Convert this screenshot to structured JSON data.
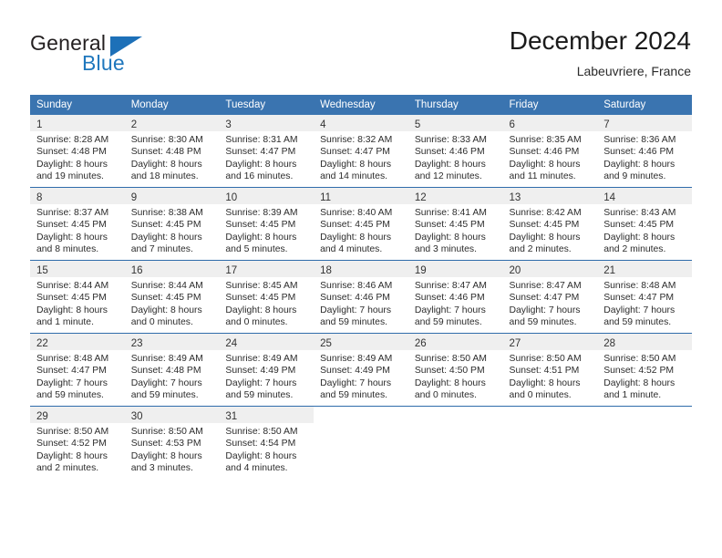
{
  "logo": {
    "word_top": "General",
    "word_bottom": "Blue",
    "mark": "sail-triangle",
    "color_black": "#231f20",
    "color_blue": "#1f77bd"
  },
  "header": {
    "title": "December 2024",
    "subtitle": "Labeuvriere, France"
  },
  "theme": {
    "header_blue": "#3a74b0",
    "row_divider_blue": "#2f6cab",
    "daynum_band": "#efefef"
  },
  "calendar": {
    "weekday_headers": [
      "Sunday",
      "Monday",
      "Tuesday",
      "Wednesday",
      "Thursday",
      "Friday",
      "Saturday"
    ],
    "weeks": [
      [
        {
          "day": "1",
          "sunrise": "Sunrise: 8:28 AM",
          "sunset": "Sunset: 4:48 PM",
          "daylight1": "Daylight: 8 hours",
          "daylight2": "and 19 minutes."
        },
        {
          "day": "2",
          "sunrise": "Sunrise: 8:30 AM",
          "sunset": "Sunset: 4:48 PM",
          "daylight1": "Daylight: 8 hours",
          "daylight2": "and 18 minutes."
        },
        {
          "day": "3",
          "sunrise": "Sunrise: 8:31 AM",
          "sunset": "Sunset: 4:47 PM",
          "daylight1": "Daylight: 8 hours",
          "daylight2": "and 16 minutes."
        },
        {
          "day": "4",
          "sunrise": "Sunrise: 8:32 AM",
          "sunset": "Sunset: 4:47 PM",
          "daylight1": "Daylight: 8 hours",
          "daylight2": "and 14 minutes."
        },
        {
          "day": "5",
          "sunrise": "Sunrise: 8:33 AM",
          "sunset": "Sunset: 4:46 PM",
          "daylight1": "Daylight: 8 hours",
          "daylight2": "and 12 minutes."
        },
        {
          "day": "6",
          "sunrise": "Sunrise: 8:35 AM",
          "sunset": "Sunset: 4:46 PM",
          "daylight1": "Daylight: 8 hours",
          "daylight2": "and 11 minutes."
        },
        {
          "day": "7",
          "sunrise": "Sunrise: 8:36 AM",
          "sunset": "Sunset: 4:46 PM",
          "daylight1": "Daylight: 8 hours",
          "daylight2": "and 9 minutes."
        }
      ],
      [
        {
          "day": "8",
          "sunrise": "Sunrise: 8:37 AM",
          "sunset": "Sunset: 4:45 PM",
          "daylight1": "Daylight: 8 hours",
          "daylight2": "and 8 minutes."
        },
        {
          "day": "9",
          "sunrise": "Sunrise: 8:38 AM",
          "sunset": "Sunset: 4:45 PM",
          "daylight1": "Daylight: 8 hours",
          "daylight2": "and 7 minutes."
        },
        {
          "day": "10",
          "sunrise": "Sunrise: 8:39 AM",
          "sunset": "Sunset: 4:45 PM",
          "daylight1": "Daylight: 8 hours",
          "daylight2": "and 5 minutes."
        },
        {
          "day": "11",
          "sunrise": "Sunrise: 8:40 AM",
          "sunset": "Sunset: 4:45 PM",
          "daylight1": "Daylight: 8 hours",
          "daylight2": "and 4 minutes."
        },
        {
          "day": "12",
          "sunrise": "Sunrise: 8:41 AM",
          "sunset": "Sunset: 4:45 PM",
          "daylight1": "Daylight: 8 hours",
          "daylight2": "and 3 minutes."
        },
        {
          "day": "13",
          "sunrise": "Sunrise: 8:42 AM",
          "sunset": "Sunset: 4:45 PM",
          "daylight1": "Daylight: 8 hours",
          "daylight2": "and 2 minutes."
        },
        {
          "day": "14",
          "sunrise": "Sunrise: 8:43 AM",
          "sunset": "Sunset: 4:45 PM",
          "daylight1": "Daylight: 8 hours",
          "daylight2": "and 2 minutes."
        }
      ],
      [
        {
          "day": "15",
          "sunrise": "Sunrise: 8:44 AM",
          "sunset": "Sunset: 4:45 PM",
          "daylight1": "Daylight: 8 hours",
          "daylight2": "and 1 minute."
        },
        {
          "day": "16",
          "sunrise": "Sunrise: 8:44 AM",
          "sunset": "Sunset: 4:45 PM",
          "daylight1": "Daylight: 8 hours",
          "daylight2": "and 0 minutes."
        },
        {
          "day": "17",
          "sunrise": "Sunrise: 8:45 AM",
          "sunset": "Sunset: 4:45 PM",
          "daylight1": "Daylight: 8 hours",
          "daylight2": "and 0 minutes."
        },
        {
          "day": "18",
          "sunrise": "Sunrise: 8:46 AM",
          "sunset": "Sunset: 4:46 PM",
          "daylight1": "Daylight: 7 hours",
          "daylight2": "and 59 minutes."
        },
        {
          "day": "19",
          "sunrise": "Sunrise: 8:47 AM",
          "sunset": "Sunset: 4:46 PM",
          "daylight1": "Daylight: 7 hours",
          "daylight2": "and 59 minutes."
        },
        {
          "day": "20",
          "sunrise": "Sunrise: 8:47 AM",
          "sunset": "Sunset: 4:47 PM",
          "daylight1": "Daylight: 7 hours",
          "daylight2": "and 59 minutes."
        },
        {
          "day": "21",
          "sunrise": "Sunrise: 8:48 AM",
          "sunset": "Sunset: 4:47 PM",
          "daylight1": "Daylight: 7 hours",
          "daylight2": "and 59 minutes."
        }
      ],
      [
        {
          "day": "22",
          "sunrise": "Sunrise: 8:48 AM",
          "sunset": "Sunset: 4:47 PM",
          "daylight1": "Daylight: 7 hours",
          "daylight2": "and 59 minutes."
        },
        {
          "day": "23",
          "sunrise": "Sunrise: 8:49 AM",
          "sunset": "Sunset: 4:48 PM",
          "daylight1": "Daylight: 7 hours",
          "daylight2": "and 59 minutes."
        },
        {
          "day": "24",
          "sunrise": "Sunrise: 8:49 AM",
          "sunset": "Sunset: 4:49 PM",
          "daylight1": "Daylight: 7 hours",
          "daylight2": "and 59 minutes."
        },
        {
          "day": "25",
          "sunrise": "Sunrise: 8:49 AM",
          "sunset": "Sunset: 4:49 PM",
          "daylight1": "Daylight: 7 hours",
          "daylight2": "and 59 minutes."
        },
        {
          "day": "26",
          "sunrise": "Sunrise: 8:50 AM",
          "sunset": "Sunset: 4:50 PM",
          "daylight1": "Daylight: 8 hours",
          "daylight2": "and 0 minutes."
        },
        {
          "day": "27",
          "sunrise": "Sunrise: 8:50 AM",
          "sunset": "Sunset: 4:51 PM",
          "daylight1": "Daylight: 8 hours",
          "daylight2": "and 0 minutes."
        },
        {
          "day": "28",
          "sunrise": "Sunrise: 8:50 AM",
          "sunset": "Sunset: 4:52 PM",
          "daylight1": "Daylight: 8 hours",
          "daylight2": "and 1 minute."
        }
      ],
      [
        {
          "day": "29",
          "sunrise": "Sunrise: 8:50 AM",
          "sunset": "Sunset: 4:52 PM",
          "daylight1": "Daylight: 8 hours",
          "daylight2": "and 2 minutes."
        },
        {
          "day": "30",
          "sunrise": "Sunrise: 8:50 AM",
          "sunset": "Sunset: 4:53 PM",
          "daylight1": "Daylight: 8 hours",
          "daylight2": "and 3 minutes."
        },
        {
          "day": "31",
          "sunrise": "Sunrise: 8:50 AM",
          "sunset": "Sunset: 4:54 PM",
          "daylight1": "Daylight: 8 hours",
          "daylight2": "and 4 minutes."
        },
        {
          "day": "",
          "sunrise": "",
          "sunset": "",
          "daylight1": "",
          "daylight2": ""
        },
        {
          "day": "",
          "sunrise": "",
          "sunset": "",
          "daylight1": "",
          "daylight2": ""
        },
        {
          "day": "",
          "sunrise": "",
          "sunset": "",
          "daylight1": "",
          "daylight2": ""
        },
        {
          "day": "",
          "sunrise": "",
          "sunset": "",
          "daylight1": "",
          "daylight2": ""
        }
      ]
    ]
  }
}
